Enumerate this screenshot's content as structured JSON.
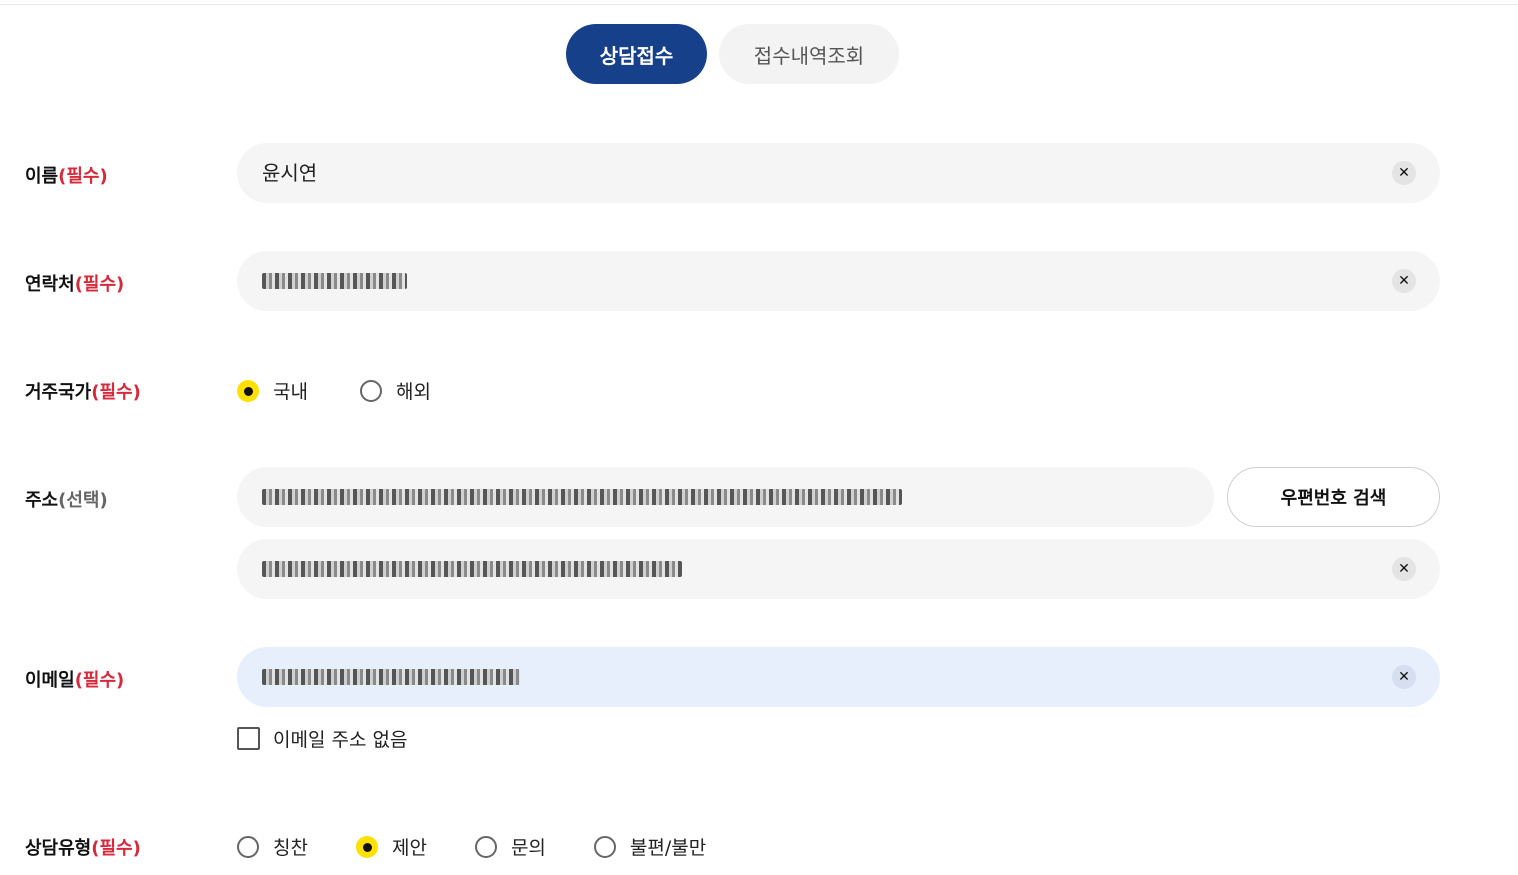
{
  "tabs": {
    "consult": "상담접수",
    "history": "접수내역조회"
  },
  "name": {
    "label": "이름",
    "required": "(필수)",
    "value": "윤시연"
  },
  "contact": {
    "label": "연락처",
    "required": "(필수)"
  },
  "country": {
    "label": "거주국가",
    "required": "(필수)",
    "options": [
      "국내",
      "해외"
    ],
    "selected": "국내"
  },
  "address": {
    "label": "주소",
    "optional": "(선택)",
    "zip_button": "우편번호 검색"
  },
  "email": {
    "label": "이메일",
    "required": "(필수)",
    "no_email_label": "이메일 주소 없음"
  },
  "type": {
    "label": "상담유형",
    "required": "(필수)",
    "options": [
      "칭찬",
      "제안",
      "문의",
      "불편/불만"
    ],
    "selected": "제안"
  },
  "icons": {
    "clear": "close-icon"
  },
  "colors": {
    "primary": "#17408b",
    "required": "#d6293b",
    "radio_checked": "#ffe100",
    "focus_field": "#e8effc"
  }
}
